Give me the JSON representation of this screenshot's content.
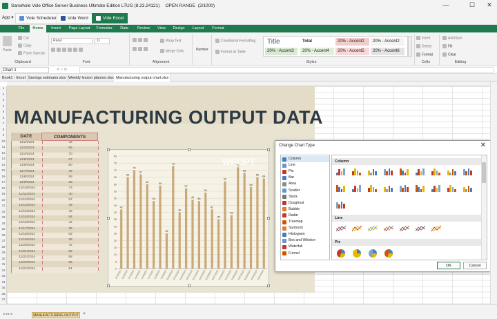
{
  "window": {
    "title": "Sanwhole Vole Office Server Business Ultimate Edition LTUG (8.23.24121)",
    "mode": "OPEN RANGE",
    "counter": "(2/1000)",
    "minimize": "—",
    "maximize": "☐",
    "close": "✕"
  },
  "app_tabs": {
    "app_menu": "App ▾",
    "items": [
      {
        "label": "Vole Scheduler",
        "color": "#5b8fd6"
      },
      {
        "label": "Vole Word",
        "color": "#2b579a"
      },
      {
        "label": "Vole Excel",
        "color": "#ffffff"
      }
    ]
  },
  "ribbon_tabs": [
    "File",
    "Home",
    "Insert",
    "Page Layout",
    "Formulas",
    "Data",
    "Review",
    "View",
    "Design",
    "Layout",
    "Format"
  ],
  "ribbon": {
    "clipboard": {
      "paste": "Paste",
      "cut": "Cut",
      "copy": "Copy",
      "paste_special": "Paste Special",
      "label": "Clipboard"
    },
    "font": {
      "name": "Raavi",
      "size": "11",
      "label": "Font"
    },
    "alignment": {
      "wrap": "Wrap Text",
      "merge": "Merge Cells",
      "label": "Alignment"
    },
    "number": {
      "format": "Number"
    },
    "styles": {
      "conditional": "Conditional Formatting",
      "format_table": "Format as Table",
      "label": "Styles",
      "cells": [
        {
          "label": "Title",
          "bg": "#ffffff",
          "fg": "#44546a"
        },
        {
          "label": "Total",
          "bg": "#ffffff",
          "fg": "#222222"
        },
        {
          "label": "20% - Accent2",
          "bg": "#f4cccc",
          "fg": "#222222"
        },
        {
          "label": "20% - Accent2",
          "bg": "#f3f3f3",
          "fg": "#222222"
        },
        {
          "label": "20% - Accent3",
          "bg": "#d9ead3",
          "fg": "#222222"
        },
        {
          "label": "20% - Accent4",
          "bg": "#e2efda",
          "fg": "#222222"
        },
        {
          "label": "20% - Accent5",
          "bg": "#f8d7d7",
          "fg": "#222222"
        },
        {
          "label": "20% - Accent6",
          "bg": "#e4e4e4",
          "fg": "#222222"
        }
      ]
    },
    "cells": {
      "insert": "Insert",
      "delete": "Delete",
      "format": "Format",
      "label": "Cells"
    },
    "editing": {
      "autosum": "AutoSum",
      "fill": "Fill",
      "clear": "Clear",
      "label": "Editing"
    }
  },
  "formula_bar": {
    "name_box": "Chart 1"
  },
  "file_tabs": [
    "Book1 - Excel",
    "Savings estimator.xlsx",
    "Weekly lesson planner.xlsx",
    "Manufacturing output chart.xlsx"
  ],
  "sheet": {
    "title": "MANUFACTURING OUTPUT DATA",
    "col_date": "DATE",
    "col_value": "COMPONENTS COMPLETED",
    "rows": [
      {
        "date": "11/2/2024",
        "value": "42"
      },
      {
        "date": "11/3/2024",
        "value": "65"
      },
      {
        "date": "11/4/2024",
        "value": "70"
      },
      {
        "date": "11/5/2024",
        "value": "67"
      },
      {
        "date": "11/6/2024",
        "value": "60"
      },
      {
        "date": "11/7/2024",
        "value": "48"
      },
      {
        "date": "11/8/2024",
        "value": "59"
      },
      {
        "date": "11/9/2024",
        "value": "25"
      },
      {
        "date": "11/10/2024",
        "value": "73"
      },
      {
        "date": "11/11/2024",
        "value": "40"
      },
      {
        "date": "11/12/2024",
        "value": "57"
      },
      {
        "date": "11/13/2024",
        "value": "49"
      },
      {
        "date": "11/14/2024",
        "value": "48"
      },
      {
        "date": "11/15/2024",
        "value": "54"
      },
      {
        "date": "11/16/2024",
        "value": "42"
      },
      {
        "date": "11/17/2024",
        "value": "35"
      },
      {
        "date": "11/18/2024",
        "value": "62"
      },
      {
        "date": "11/19/2024",
        "value": "38"
      },
      {
        "date": "11/20/2024",
        "value": "72"
      },
      {
        "date": "11/21/2024",
        "value": "68"
      },
      {
        "date": "11/22/2024",
        "value": "58"
      },
      {
        "date": "11/23/2024",
        "value": "65"
      },
      {
        "date": "11/24/2024",
        "value": "64"
      }
    ],
    "tab_name": "MANUFACTURING OUTPUT",
    "colors": {
      "header": "#d9c9b0",
      "band": "#e9e3d2",
      "bar": "#c8a978"
    }
  },
  "chart_data": {
    "type": "bar",
    "categories": [
      "11/2/2024",
      "11/3/2024",
      "11/4/2024",
      "11/5/2024",
      "11/6/2024",
      "11/7/2024",
      "11/8/2024",
      "11/9/2024",
      "11/10/2024",
      "11/11/2024",
      "11/12/2024",
      "11/13/2024",
      "11/14/2024",
      "11/15/2024",
      "11/16/2024",
      "11/17/2024",
      "11/18/2024",
      "11/19/2024",
      "11/20/2024",
      "11/21/2024",
      "11/22/2024",
      "11/23/2024",
      "11/24/2024"
    ],
    "values": [
      42,
      65,
      70,
      67,
      60,
      48,
      59,
      25,
      73,
      40,
      57,
      49,
      48,
      54,
      42,
      35,
      62,
      38,
      72,
      68,
      58,
      65,
      64
    ],
    "yticks": [
      "0",
      "5",
      "10",
      "15",
      "20",
      "25",
      "30",
      "35",
      "40",
      "45",
      "50",
      "55",
      "60",
      "65",
      "70",
      "75",
      "80"
    ],
    "ylim": [
      0,
      80
    ],
    "grid": true,
    "watermark": "WPOPT"
  },
  "dialog": {
    "title": "Change Chart Type",
    "close": "✕",
    "types": [
      {
        "label": "Column",
        "color": "#4a7ebb"
      },
      {
        "label": "Line",
        "color": "#6f95c9"
      },
      {
        "label": "Pie",
        "color": "#c0392b"
      },
      {
        "label": "Bar",
        "color": "#4a7ebb"
      },
      {
        "label": "Area",
        "color": "#8c8c8c"
      },
      {
        "label": "Scatter",
        "color": "#5b9bd5"
      },
      {
        "label": "Stock",
        "color": "#777777"
      },
      {
        "label": "Doughnut",
        "color": "#c0392b"
      },
      {
        "label": "Bubble",
        "color": "#e07b39"
      },
      {
        "label": "Radar",
        "color": "#c0392b"
      },
      {
        "label": "Treemap",
        "color": "#d35400"
      },
      {
        "label": "Sunburst",
        "color": "#e07b39"
      },
      {
        "label": "Histogram",
        "color": "#4a7ebb"
      },
      {
        "label": "Box and Whisker",
        "color": "#6f95c9"
      },
      {
        "label": "Waterfall",
        "color": "#c0392b"
      },
      {
        "label": "Funnel",
        "color": "#d35400"
      }
    ],
    "sections": {
      "column": "Column",
      "line": "Line",
      "pie": "Pie"
    },
    "ok": "OK",
    "cancel": "Cancel"
  }
}
